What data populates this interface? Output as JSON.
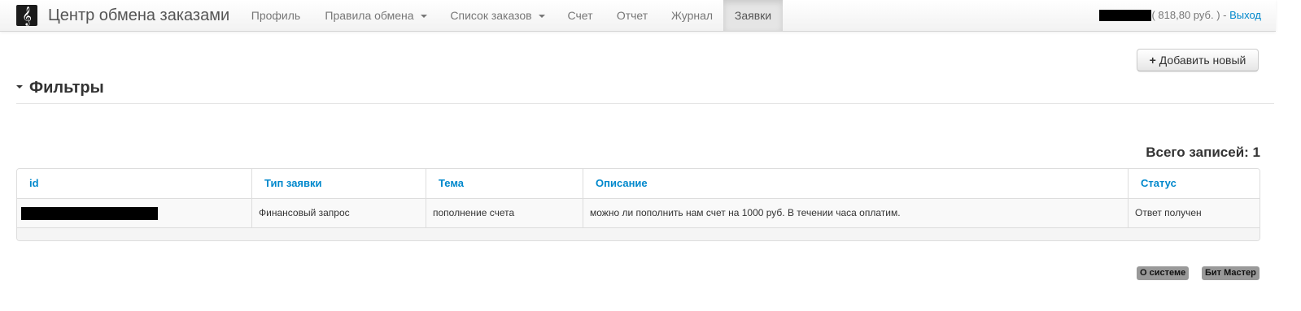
{
  "navbar": {
    "brand": "Центр обмена заказами",
    "logo_glyph": "𝄞",
    "items": [
      {
        "label": "Профиль"
      },
      {
        "label": "Правила обмена"
      },
      {
        "label": "Список заказов"
      },
      {
        "label": "Счет"
      },
      {
        "label": "Отчет"
      },
      {
        "label": "Журнал"
      },
      {
        "label": "Заявки"
      }
    ],
    "active_item": "Заявки",
    "balance": "( 818,80 руб. ) - ",
    "logout": "Выход"
  },
  "toolbar": {
    "add_button": "Добавить новый",
    "add_icon": "+"
  },
  "filters": {
    "title": "Фильтры"
  },
  "summary": {
    "total": "Всего записей: 1"
  },
  "table": {
    "columns": [
      "id",
      "Тип заявки",
      "Тема",
      "Описание",
      "Статус"
    ],
    "rows": [
      {
        "type": "Финансовый запрос",
        "subject": "пополнение счета",
        "description": "можно ли пополнить нам счет на 1000 руб. В течении часа оплатим.",
        "status": "Ответ получен"
      }
    ]
  },
  "footer": {
    "about": "О системе",
    "vendor": "Бит Мастер"
  },
  "colors": {
    "link": "#0088cc",
    "badge": "#999999"
  }
}
